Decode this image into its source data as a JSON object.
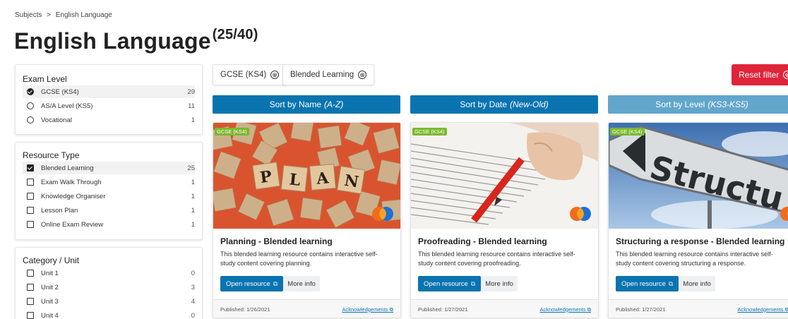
{
  "breadcrumb": {
    "parent": "Subjects",
    "separator": ">",
    "current": "English Language"
  },
  "page": {
    "title": "English Language",
    "count": "(25/40)"
  },
  "filters": {
    "exam_level": {
      "title": "Exam Level",
      "items": [
        {
          "label": "GCSE (KS4)",
          "count": "29",
          "checked": true
        },
        {
          "label": "AS/A Level (KS5)",
          "count": "11",
          "checked": false
        },
        {
          "label": "Vocational",
          "count": "1",
          "checked": false
        }
      ]
    },
    "resource_type": {
      "title": "Resource Type",
      "items": [
        {
          "label": "Blended Learning",
          "count": "25",
          "checked": true
        },
        {
          "label": "Exam Walk Through",
          "count": "1",
          "checked": false
        },
        {
          "label": "Knowledge Organiser",
          "count": "1",
          "checked": false
        },
        {
          "label": "Lesson Plan",
          "count": "1",
          "checked": false
        },
        {
          "label": "Online Exam Review",
          "count": "1",
          "checked": false
        }
      ]
    },
    "category": {
      "title": "Category / Unit",
      "items": [
        {
          "label": "Unit 1",
          "count": "0",
          "checked": false
        },
        {
          "label": "Unit 2",
          "count": "3",
          "checked": false
        },
        {
          "label": "Unit 3",
          "count": "4",
          "checked": false
        },
        {
          "label": "Unit 4",
          "count": "0",
          "checked": false
        }
      ]
    }
  },
  "active_filters": [
    "GCSE (KS4)",
    "Blended Learning"
  ],
  "remove_glyph": "⊗",
  "reset_label": "Reset filter",
  "sort": {
    "name": {
      "label": "Sort by Name",
      "suffix": "(A-Z)"
    },
    "date": {
      "label": "Sort by Date",
      "suffix": "(New-Old)"
    },
    "level": {
      "label": "Sort by Level",
      "suffix": "(KS3-KS5)"
    }
  },
  "cards": [
    {
      "tag": "GCSE (KS4)",
      "image_icon": "scrabble-tiles-plan-image",
      "title": "Planning - Blended learning",
      "description": "This blended learning resource contains interactive self-study content covering planning.",
      "open_label": "Open resource",
      "more_label": "More info",
      "published": "Published: 1/26/2021",
      "ack": "Acknowledgements"
    },
    {
      "tag": "GCSE (KS4)",
      "image_icon": "proofreading-pen-image",
      "title": "Proofreading - Blended learning",
      "description": "This blended learning resource contains interactive self-study content covering proofreading.",
      "open_label": "Open resource",
      "more_label": "More info",
      "published": "Published: 1/27/2021",
      "ack": "Acknowledgements"
    },
    {
      "tag": "GCSE (KS4)",
      "image_icon": "structure-sign-image",
      "title": "Structuring a response - Blended learning",
      "description": "This blended learning resource contains interactive self-study content covering structuring a response.",
      "open_label": "Open resource",
      "more_label": "More info",
      "published": "Published: 1/27/2021",
      "ack": "Acknowledgements"
    }
  ],
  "image_text": {
    "plan_tiles": [
      "P",
      "L",
      "A",
      "N"
    ],
    "sign": "Structu"
  },
  "colors": {
    "primary": "#0a74b0",
    "primary_light": "#62a6cc",
    "danger": "#e0243a",
    "tag_green": "#7cb82f",
    "logo_orange": "#f26b1d",
    "logo_blue": "#1e6fd9"
  }
}
